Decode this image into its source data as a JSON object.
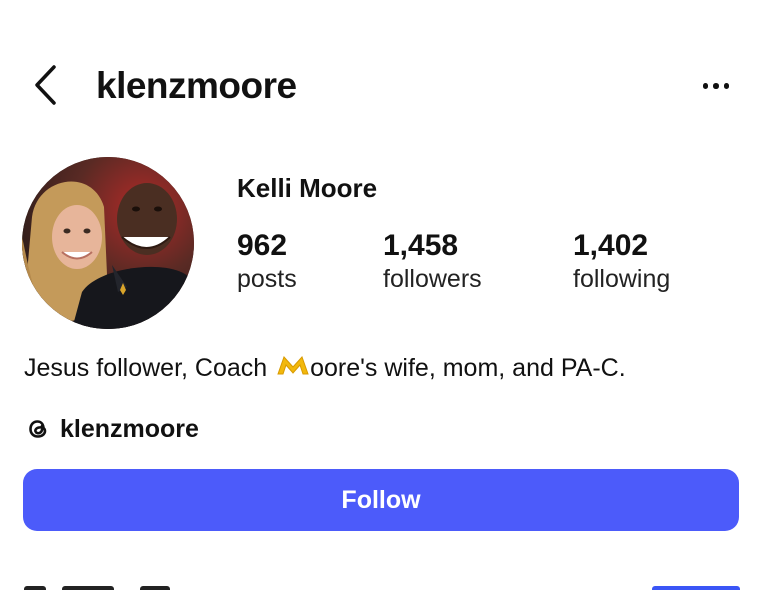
{
  "header": {
    "username": "klenzmoore",
    "back_icon": "chevron-left-icon",
    "more_icon": "more-horizontal-icon"
  },
  "profile": {
    "full_name": "Kelli Moore",
    "avatar_icon": "profile-photo"
  },
  "stats": [
    {
      "value": "962",
      "label": "posts"
    },
    {
      "value": "1,458",
      "label": "followers"
    },
    {
      "value": "1,402",
      "label": "following"
    }
  ],
  "bio": {
    "text_before": "Jesus follower, Coach ",
    "emoji_icon": "michigan-m-block-icon",
    "text_after": "oore's wife, mom, and PA-C."
  },
  "threads": {
    "icon": "threads-icon",
    "handle": "klenzmoore"
  },
  "actions": {
    "follow_label": "Follow"
  },
  "colors": {
    "follow_button": "#4c5bfa",
    "emoji_maize": "#f2b80c",
    "link_blue": "#3a55f6"
  }
}
